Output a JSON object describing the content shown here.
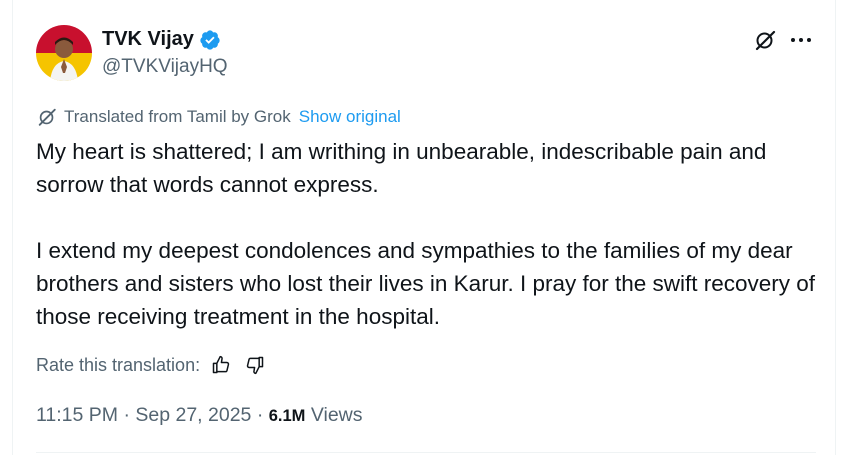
{
  "author": {
    "display_name": "TVK Vijay",
    "handle": "@TVKVijayHQ",
    "verified": true
  },
  "translation": {
    "label": "Translated from Tamil by Grok",
    "show_original": "Show original",
    "rate_label": "Rate this translation:"
  },
  "tweet": {
    "paragraphs": [
      "My heart is shattered; I am writhing in unbearable, indescribable pain and sorrow that words cannot express.",
      "I extend my deepest condolences and sympathies to the families of my dear brothers and sisters who lost their lives in Karur. I pray for the swift recovery of those receiving treatment in the hospital."
    ]
  },
  "meta": {
    "time": "11:15 PM",
    "separator": " · ",
    "date": "Sep 27, 2025",
    "views_count": "6.1M",
    "views_label": " Views"
  },
  "icons": {
    "verified": "verified-badge-icon",
    "grok": "grok-icon",
    "more": "more-options-icon",
    "thumbs_up": "thumbs-up-icon",
    "thumbs_down": "thumbs-down-icon"
  },
  "colors": {
    "text": "#0f1419",
    "secondary": "#536471",
    "link": "#1d9bf0",
    "border": "#eff3f4"
  }
}
